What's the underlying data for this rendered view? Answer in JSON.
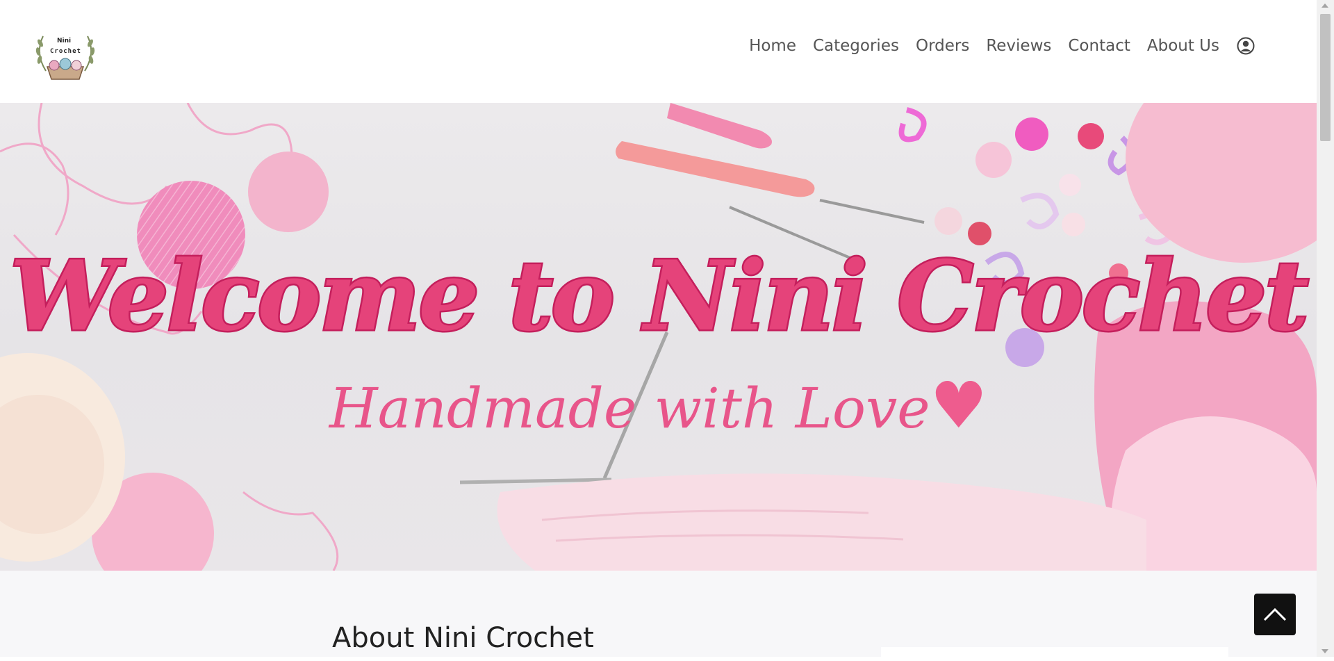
{
  "brand": {
    "logo_text_line1": "Nini",
    "logo_text_line2": "Crochet"
  },
  "nav": {
    "items": [
      {
        "label": "Home"
      },
      {
        "label": "Categories"
      },
      {
        "label": "Orders"
      },
      {
        "label": "Reviews"
      },
      {
        "label": "Contact"
      },
      {
        "label": "About Us"
      }
    ],
    "account_icon": "user-circle-icon"
  },
  "hero": {
    "title": "Welcome to Nini Crochet",
    "subtitle": "Handmade with Love",
    "heart": "♥",
    "colors": {
      "title_fill": "#e5437a",
      "title_stroke": "#c41f5c",
      "subtitle": "#e8558a",
      "background": "#e8e6e9"
    }
  },
  "about": {
    "title": "About Nini Crochet"
  },
  "scroll_top": {
    "icon": "chevron-up-icon"
  }
}
